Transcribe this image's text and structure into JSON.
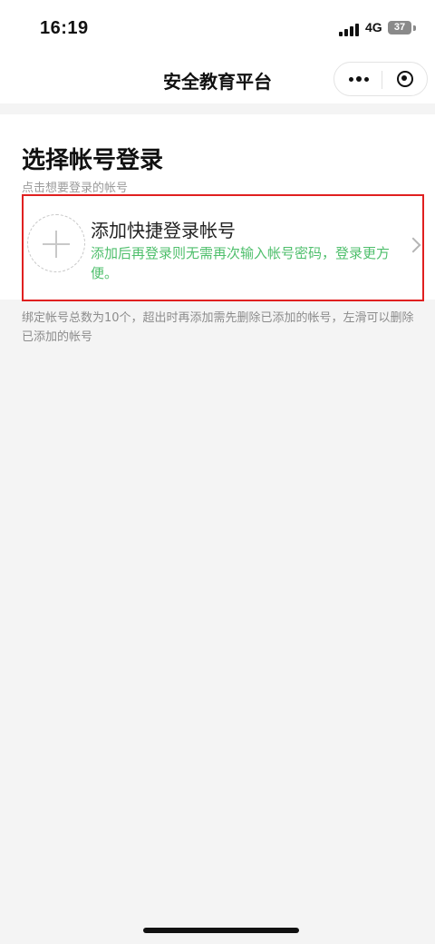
{
  "status_bar": {
    "time": "16:19",
    "network": "4G",
    "battery": "37"
  },
  "nav": {
    "title": "安全教育平台",
    "more_icon": "more-dots-icon",
    "close_icon": "target-close-icon"
  },
  "main": {
    "title": "选择帐号登录",
    "subtitle": "点击想要登录的帐号",
    "add_account": {
      "title": "添加快捷登录帐号",
      "description": "添加后再登录则无需再次输入帐号密码，登录更方便。",
      "icon": "plus-icon",
      "accent_color": "#4fbf6c"
    },
    "note": "绑定帐号总数为10个，超出时再添加需先删除已添加的帐号，左滑可以删除已添加的帐号"
  },
  "colors": {
    "highlight_border": "#e02020",
    "background": "#f4f4f4"
  }
}
